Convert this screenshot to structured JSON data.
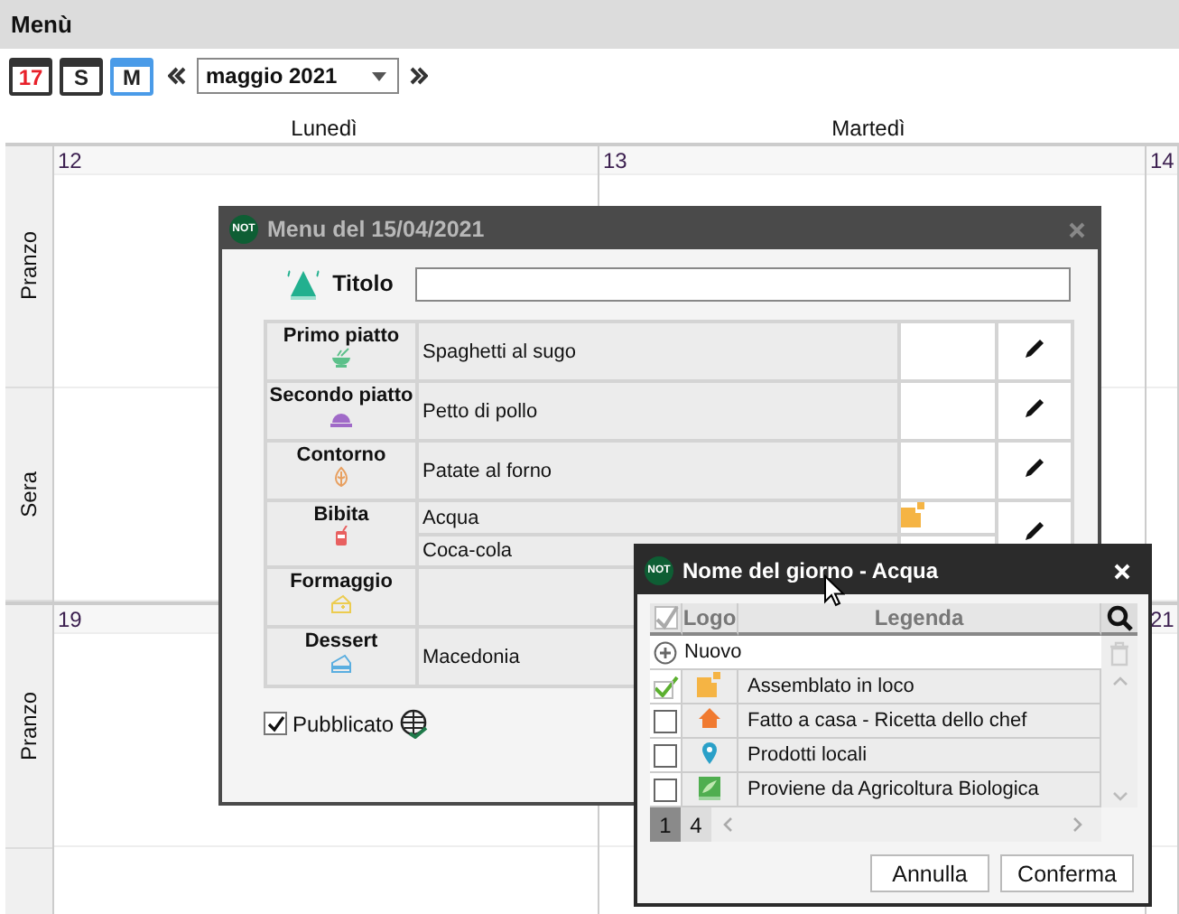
{
  "header": {
    "title": "Menù"
  },
  "toolbar": {
    "views": [
      {
        "kind": "day",
        "label": "17",
        "selected": false
      },
      {
        "kind": "week",
        "label": "S",
        "selected": false
      },
      {
        "kind": "month",
        "label": "M",
        "selected": true
      }
    ],
    "month": "maggio 2021"
  },
  "calendar": {
    "days": [
      "Lunedì",
      "Martedì"
    ],
    "weeks": [
      {
        "dates": [
          "12",
          "13",
          "14"
        ],
        "slots": [
          "Pranzo",
          "Sera"
        ]
      },
      {
        "dates": [
          "19",
          "21"
        ],
        "slots": [
          "Pranzo"
        ]
      }
    ]
  },
  "menu_dialog": {
    "badge": "NOT",
    "title": "Menu del 15/04/2021",
    "title_label": "Titolo",
    "courses": [
      {
        "name": "Primo piatto",
        "kind": "bowl",
        "editable": true,
        "dishes": [
          {
            "name": "Spaghetti al sugo",
            "kind": "plain"
          }
        ]
      },
      {
        "name": "Secondo piatto",
        "kind": "cloche",
        "editable": true,
        "dishes": [
          {
            "name": "Petto di pollo",
            "kind": "plain"
          }
        ]
      },
      {
        "name": "Contorno",
        "kind": "leaf",
        "editable": true,
        "dishes": [
          {
            "name": "Patate al forno",
            "kind": "plain"
          }
        ]
      },
      {
        "name": "Bibita",
        "kind": "cup",
        "editable": true,
        "dishes": [
          {
            "name": "Acqua",
            "kind": "squares"
          },
          {
            "name": "Coca-cola",
            "kind": "plain"
          }
        ]
      },
      {
        "name": "Formaggio",
        "kind": "cheese",
        "editable": false
      },
      {
        "name": "Dessert",
        "kind": "cake",
        "editable": false,
        "dishes": [
          {
            "name": "Macedonia",
            "kind": "plain"
          }
        ]
      }
    ],
    "published": {
      "label": "Pubblicato",
      "checked": true
    }
  },
  "logo_dialog": {
    "badge": "NOT",
    "title": "Nome del giorno - Acqua",
    "columns": [
      "Logo",
      "Legenda"
    ],
    "new_label": "Nuovo",
    "logos": [
      {
        "kind": "squares",
        "label": "Assemblato in loco",
        "checked": true
      },
      {
        "kind": "house",
        "label": "Fatto a casa - Ricetta dello chef",
        "checked": false
      },
      {
        "kind": "pin",
        "label": "Prodotti locali",
        "checked": false
      },
      {
        "kind": "bio",
        "label": "Proviene da Agricoltura Biologica",
        "checked": false
      }
    ],
    "pages": [
      {
        "label": "1",
        "selected": true
      },
      {
        "label": "4",
        "selected": false
      }
    ],
    "buttons": [
      "Annulla",
      "Conferma"
    ]
  }
}
